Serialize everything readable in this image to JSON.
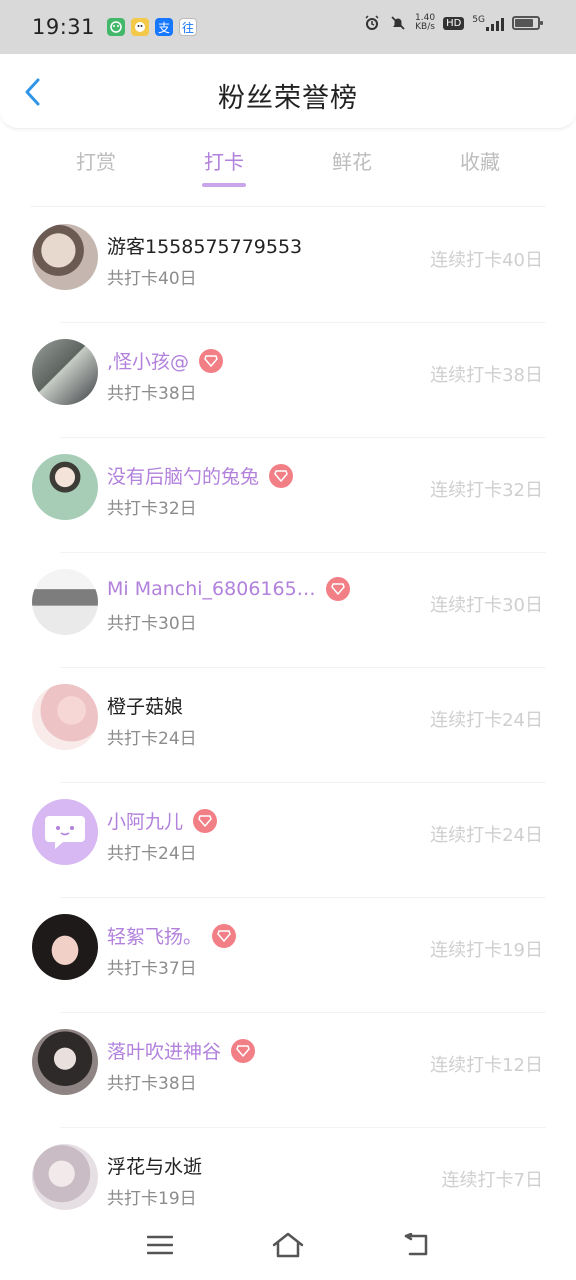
{
  "status_bar": {
    "time": "19:31",
    "net_speed_value": "1.40",
    "net_speed_unit": "KB/s",
    "hd_label": "HD",
    "network_label": "5G",
    "battery_level": 0.85,
    "app_icons": [
      "app-notification-icon-1",
      "app-notification-icon-2",
      "alipay-icon",
      "app-notification-icon-4"
    ],
    "alipay_glyph": "支",
    "app4_glyph": "往"
  },
  "header": {
    "title": "粉丝荣誉榜",
    "back_icon": "chevron-left-icon"
  },
  "tabs": [
    {
      "label": "打赏",
      "active": false
    },
    {
      "label": "打卡",
      "active": true
    },
    {
      "label": "鲜花",
      "active": false
    },
    {
      "label": "收藏",
      "active": false
    }
  ],
  "colors": {
    "accent": "#b281dc",
    "vip_badge": "#f27f85",
    "streak_text": "#cfcfcf",
    "total_text": "#8c8c8c"
  },
  "fans": [
    {
      "name": "游客1558575779553",
      "vip": false,
      "total": "共打卡40日",
      "streak": "连续打卡40日"
    },
    {
      "name": ",怪小孩@",
      "vip": true,
      "total": "共打卡38日",
      "streak": "连续打卡38日"
    },
    {
      "name": "没有后脑勺的兔兔",
      "vip": true,
      "total": "共打卡32日",
      "streak": "连续打卡32日"
    },
    {
      "name": "Mi Manchi_6806165…",
      "vip": true,
      "total": "共打卡30日",
      "streak": "连续打卡30日"
    },
    {
      "name": "橙子菇娘",
      "vip": false,
      "total": "共打卡24日",
      "streak": "连续打卡24日"
    },
    {
      "name": "小阿九儿",
      "vip": true,
      "total": "共打卡24日",
      "streak": "连续打卡24日"
    },
    {
      "name": "轻絮飞扬。",
      "vip": true,
      "total": "共打卡37日",
      "streak": "连续打卡19日"
    },
    {
      "name": "落叶吹进神谷",
      "vip": true,
      "total": "共打卡38日",
      "streak": "连续打卡12日"
    },
    {
      "name": "浮花与水逝",
      "vip": false,
      "total": "共打卡19日",
      "streak": "连续打卡7日"
    }
  ],
  "bottom_nav": {
    "icons": [
      "menu-icon",
      "home-icon",
      "back-icon"
    ]
  }
}
